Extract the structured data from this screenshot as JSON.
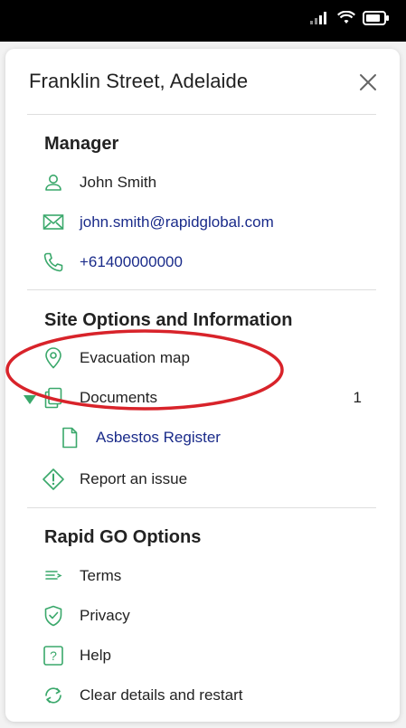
{
  "colors": {
    "accent_green": "#3aa86b",
    "link_blue": "#1a2b8a",
    "annotation_red": "#d8232a"
  },
  "header": {
    "title": "Franklin Street, Adelaide",
    "close_icon": "close-icon"
  },
  "manager": {
    "section_title": "Manager",
    "items": [
      {
        "icon": "person-icon",
        "label": "John Smith"
      },
      {
        "icon": "mail-icon",
        "label": "john.smith@rapidglobal.com"
      },
      {
        "icon": "phone-icon",
        "label": "+61400000000"
      }
    ]
  },
  "site_options": {
    "section_title": "Site Options and Information",
    "items": [
      {
        "icon": "location-pin-icon",
        "label": "Evacuation map"
      },
      {
        "icon": "documents-icon",
        "label": "Documents",
        "count": "1"
      },
      {
        "icon": "document-icon",
        "label": "Asbestos Register"
      },
      {
        "icon": "warning-diamond-icon",
        "label": "Report an issue"
      }
    ]
  },
  "rapid_go": {
    "section_title": "Rapid GO Options",
    "items": [
      {
        "icon": "list-icon",
        "label": "Terms"
      },
      {
        "icon": "shield-check-icon",
        "label": "Privacy"
      },
      {
        "icon": "help-icon",
        "label": "Help"
      },
      {
        "icon": "refresh-icon",
        "label": "Clear details and restart"
      }
    ]
  }
}
